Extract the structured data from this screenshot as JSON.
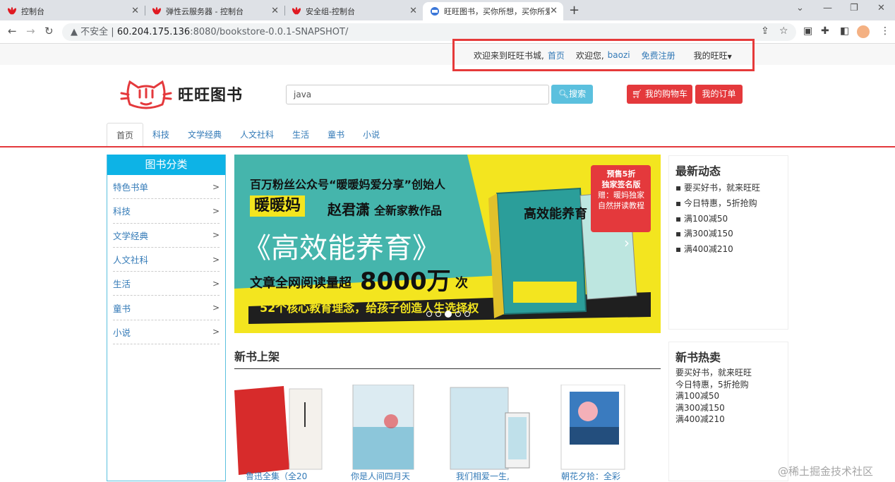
{
  "browser": {
    "tabs": [
      {
        "title": "控制台"
      },
      {
        "title": "弹性云服务器 - 控制台"
      },
      {
        "title": "安全组-控制台"
      },
      {
        "title": "旺旺图书，买你所想，买你所爱"
      }
    ],
    "address": {
      "security": "不安全",
      "host": "60.204.175.136",
      "path": ":8080/bookstore-0.0.1-SNAPSHOT/"
    }
  },
  "topbar": {
    "welcome_site": "欢迎来到旺旺书城,",
    "home_link": "首页",
    "welcome_user": "欢迎您,",
    "username": "baozi",
    "register": "免费注册",
    "my_account": "我的旺旺"
  },
  "header": {
    "logo_text": "旺旺图书",
    "search_value": "java",
    "search_button": "搜索",
    "cart_button": "我的购物车",
    "orders_button": "我的订单"
  },
  "menu": [
    "首页",
    "科技",
    "文学经典",
    "人文社科",
    "生活",
    "童书",
    "小说"
  ],
  "categories": {
    "title": "图书分类",
    "items": [
      "特色书单",
      "科技",
      "文学经典",
      "人文社科",
      "生活",
      "童书",
      "小说"
    ],
    "arrow": ">"
  },
  "banner": {
    "line1": "百万粉丝公众号“暖暖妈爱分享”创始人",
    "author_tag": "暖暖妈",
    "author": "赵君潇",
    "subtitle": "全新家教作品",
    "book_title": "《高效能养育》",
    "read_prefix": "文章全网阅读量超",
    "read_number": "8000万",
    "read_suffix": "次",
    "bottom_line": "52个核心教育理念，给孩子创造人生选择权",
    "promo_line1": "预售5折",
    "promo_line2": "独家签名版",
    "promo_line3": "赠：暖妈独家",
    "promo_line4": "自然拼读教程",
    "cover_title": "高效能养育"
  },
  "new_books": {
    "title": "新书上架",
    "items": [
      {
        "name": "鲁迅全集（全20",
        "color": "#d72b2b"
      },
      {
        "name": "你是人间四月天",
        "color": "#dcebf2"
      },
      {
        "name": "我们相爱一生,",
        "color": "#cfe6ef"
      },
      {
        "name": "朝花夕拾：全彩",
        "color": "#3a7bbf"
      }
    ]
  },
  "news": {
    "title": "最新动态",
    "items": [
      "要买好书，就来旺旺",
      "今日特惠，5折抢购",
      "满100减50",
      "满300减150",
      "满400减210"
    ]
  },
  "hot": {
    "title": "新书热卖",
    "items": [
      "要买好书，就来旺旺",
      "今日特惠，5折抢购",
      "满100减50",
      "满300减150",
      "满400减210"
    ]
  },
  "watermark": "@稀土掘金技术社区",
  "colors": {
    "accent_red": "#e4393c",
    "info_blue": "#5bc0de",
    "link_blue": "#337ab7"
  }
}
